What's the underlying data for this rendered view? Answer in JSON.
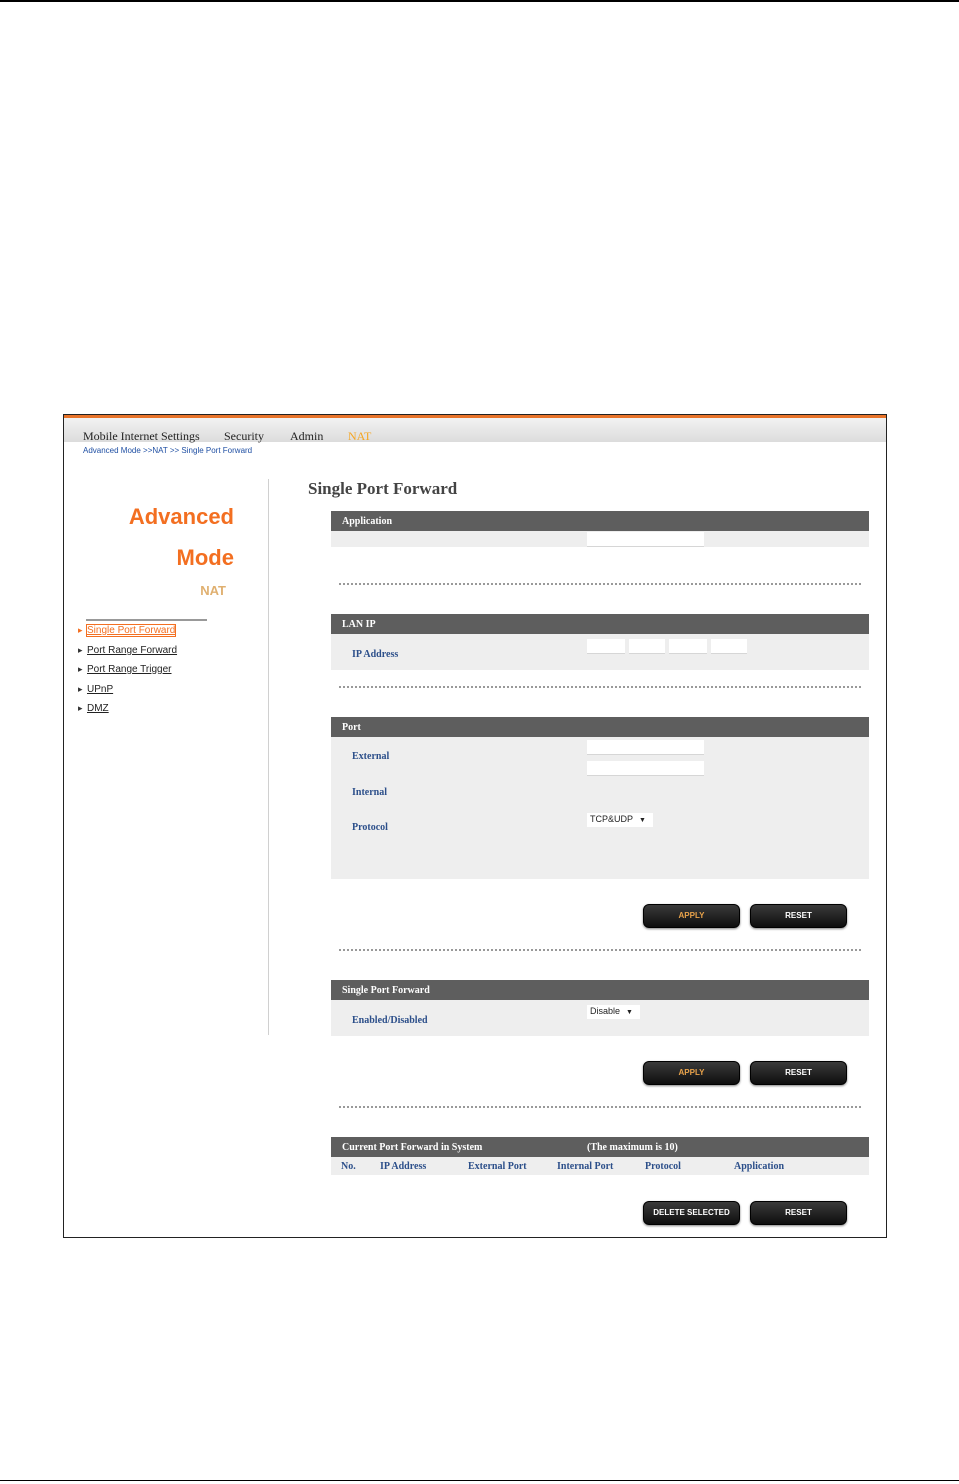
{
  "nav": {
    "items": [
      "Mobile Internet Settings",
      "Security",
      "Admin",
      "NAT"
    ],
    "active": "NAT"
  },
  "breadcrumb": "Advanced Mode >>NAT >> Single Port Forward",
  "sidebar": {
    "title_line1": "Advanced",
    "title_line2": "Mode",
    "subtitle": "NAT",
    "items": [
      {
        "label": "Single Port Forward",
        "active": true
      },
      {
        "label": "Port Range Forward",
        "active": false
      },
      {
        "label": "Port Range Trigger",
        "active": false
      },
      {
        "label": "UPnP",
        "active": false
      },
      {
        "label": "DMZ",
        "active": false
      }
    ]
  },
  "main": {
    "title": "Single Port Forward",
    "application": {
      "header": "Application",
      "value": ""
    },
    "lan_ip": {
      "header": "LAN IP",
      "ip_label": "IP Address",
      "octets": [
        "",
        "",
        "",
        ""
      ]
    },
    "port": {
      "header": "Port",
      "external_label": "External",
      "external_value": "",
      "internal_label": "Internal",
      "internal_value": "",
      "protocol_label": "Protocol",
      "protocol_value": "TCP&UDP"
    },
    "buttons1": {
      "apply": "APPLY",
      "reset": "RESET"
    },
    "spf": {
      "header": "Single Port Forward",
      "enabled_label": "Enabled/Disabled",
      "enabled_value": "Disable"
    },
    "buttons2": {
      "apply": "APPLY",
      "reset": "RESET"
    },
    "current": {
      "header": "Current Port Forward in System",
      "max_note": "(The maximum is 10)",
      "columns": [
        "No.",
        "IP Address",
        "External Port",
        "Internal Port",
        "Protocol",
        "Application"
      ],
      "rows": []
    },
    "buttons3": {
      "delete": "DELETE SELECTED",
      "reset": "RESET"
    }
  },
  "colors": {
    "accent": "#f36f21",
    "header_bg": "#5e5e5e",
    "label_blue": "#2c4f8a"
  },
  "icons": {
    "menu_bullet": "bullet-icon",
    "select_arrow": "dropdown-arrow-icon"
  }
}
